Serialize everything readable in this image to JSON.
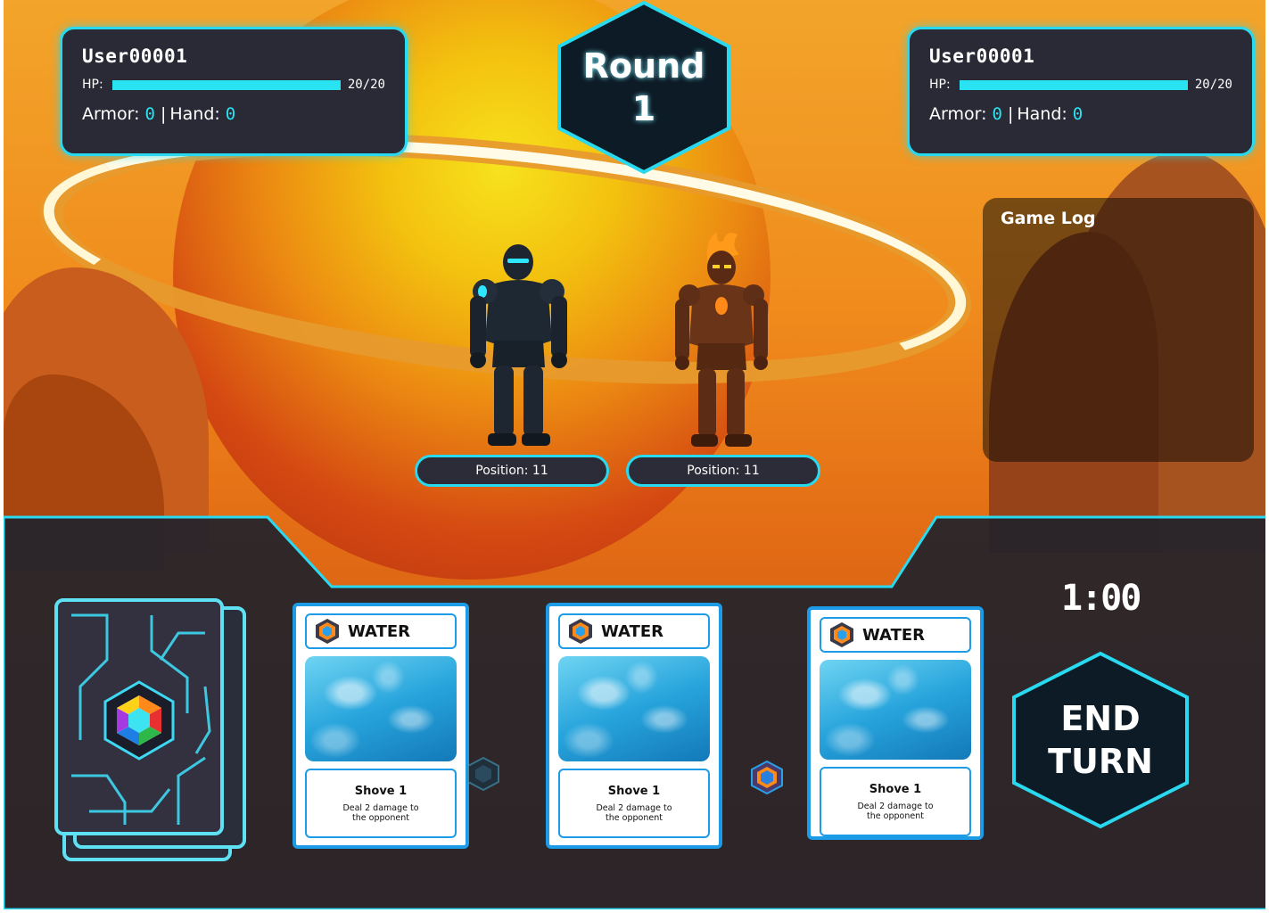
{
  "round": {
    "label": "Round",
    "number": "1"
  },
  "players": [
    {
      "name": "User00001",
      "hp_label": "HP:",
      "hp_value": "20/20",
      "hp_fraction": 1.0,
      "armor_label": "Armor:",
      "armor_value": "0",
      "hand_label": "Hand:",
      "hand_value": "0"
    },
    {
      "name": "User00001",
      "hp_label": "HP:",
      "hp_value": "20/20",
      "hp_fraction": 1.0,
      "armor_label": "Armor:",
      "armor_value": "0",
      "hand_label": "Hand:",
      "hand_value": "0"
    }
  ],
  "game_log": {
    "title": "Game Log"
  },
  "positions": [
    "Position: 11",
    "Position: 11"
  ],
  "cards": [
    {
      "element": "WATER",
      "name": "Shove 1",
      "description": "Deal 2 damage to the opponent"
    },
    {
      "element": "WATER",
      "name": "Shove 1",
      "description": "Deal 2 damage to the opponent"
    },
    {
      "element": "WATER",
      "name": "Shove 1",
      "description": "Deal 2 damage to the opponent"
    }
  ],
  "timer": "1:00",
  "end_turn": {
    "label": "END TURN"
  },
  "colors": {
    "accent": "#29d9ef",
    "panel": "#2a2a36",
    "card_border": "#1c9be6",
    "hex_fill": "#0d1b26"
  },
  "icons": {
    "deck": "card-deck-icon",
    "element": "element-emblem-icon",
    "gem": "gem-icon"
  }
}
